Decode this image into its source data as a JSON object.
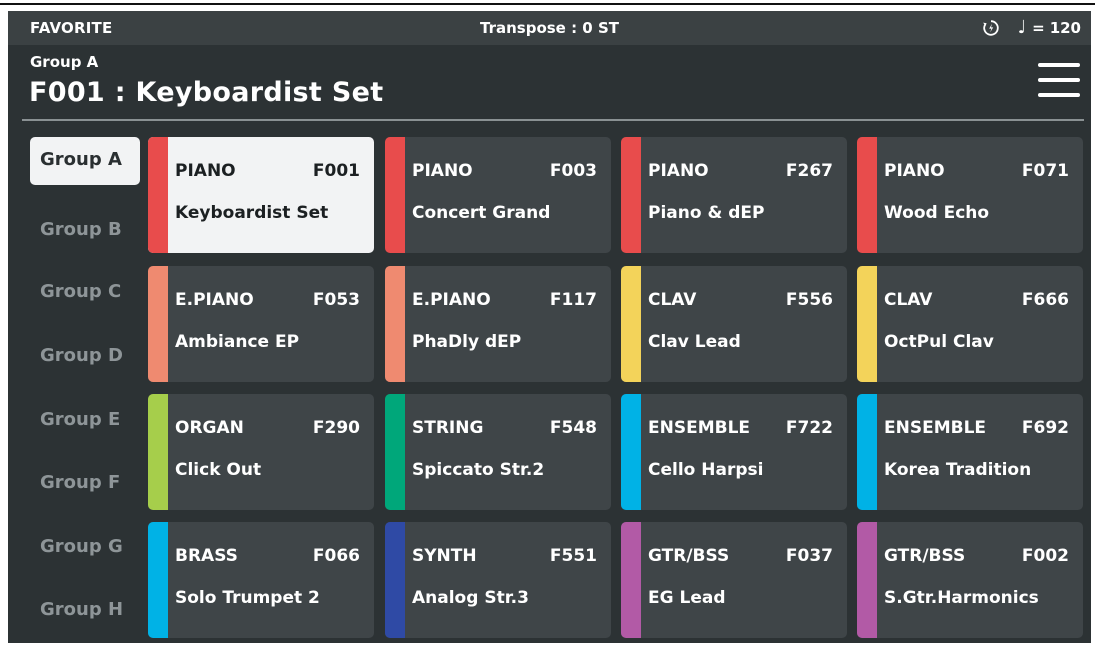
{
  "statusbar": {
    "mode": "FAVORITE",
    "transpose": "Transpose : 0 ST",
    "sync_icon": "sync-icon",
    "note_icon": "quarter-note-icon",
    "note_glyph": "♩",
    "tempo_eq": "=",
    "tempo": "120"
  },
  "header": {
    "group": "Group A",
    "title": "F001 : Keyboardist Set",
    "menu_icon": "hamburger-menu-icon"
  },
  "groups": [
    {
      "label": "Group A",
      "active": true
    },
    {
      "label": "Group B",
      "active": false
    },
    {
      "label": "Group C",
      "active": false
    },
    {
      "label": "Group D",
      "active": false
    },
    {
      "label": "Group E",
      "active": false
    },
    {
      "label": "Group F",
      "active": false
    },
    {
      "label": "Group G",
      "active": false
    },
    {
      "label": "Group H",
      "active": false
    }
  ],
  "colors": {
    "piano": "#e84c4c",
    "epiano": "#ef8a70",
    "clav": "#f3d35a",
    "organ": "#a6ce4b",
    "string": "#00a77a",
    "ensemble": "#00b2e6",
    "brass": "#00b2e6",
    "synth": "#2f4aa5",
    "gtrbss": "#b25aa6",
    "screen_bg": "#2c3234",
    "tile_bg": "#3f4548",
    "selected_bg": "#f2f3f4"
  },
  "tiles": [
    {
      "category": "PIANO",
      "number": "F001",
      "name": "Keyboardist Set",
      "color": "#e84c4c",
      "selected": true
    },
    {
      "category": "PIANO",
      "number": "F003",
      "name": "Concert Grand",
      "color": "#e84c4c",
      "selected": false
    },
    {
      "category": "PIANO",
      "number": "F267",
      "name": "Piano & dEP",
      "color": "#e84c4c",
      "selected": false
    },
    {
      "category": "PIANO",
      "number": "F071",
      "name": "Wood Echo",
      "color": "#e84c4c",
      "selected": false
    },
    {
      "category": "E.PIANO",
      "number": "F053",
      "name": "Ambiance EP",
      "color": "#ef8a70",
      "selected": false
    },
    {
      "category": "E.PIANO",
      "number": "F117",
      "name": "PhaDly dEP",
      "color": "#ef8a70",
      "selected": false
    },
    {
      "category": "CLAV",
      "number": "F556",
      "name": "Clav Lead",
      "color": "#f3d35a",
      "selected": false
    },
    {
      "category": "CLAV",
      "number": "F666",
      "name": "OctPul Clav",
      "color": "#f3d35a",
      "selected": false
    },
    {
      "category": "ORGAN",
      "number": "F290",
      "name": "Click Out",
      "color": "#a6ce4b",
      "selected": false
    },
    {
      "category": "STRING",
      "number": "F548",
      "name": "Spiccato Str.2",
      "color": "#00a77a",
      "selected": false
    },
    {
      "category": "ENSEMBLE",
      "number": "F722",
      "name": "Cello Harpsi",
      "color": "#00b2e6",
      "selected": false
    },
    {
      "category": "ENSEMBLE",
      "number": "F692",
      "name": "Korea Tradition",
      "color": "#00b2e6",
      "selected": false
    },
    {
      "category": "BRASS",
      "number": "F066",
      "name": "Solo Trumpet 2",
      "color": "#00b2e6",
      "selected": false
    },
    {
      "category": "SYNTH",
      "number": "F551",
      "name": "Analog Str.3",
      "color": "#2f4aa5",
      "selected": false
    },
    {
      "category": "GTR/BSS",
      "number": "F037",
      "name": "EG Lead",
      "color": "#b25aa6",
      "selected": false
    },
    {
      "category": "GTR/BSS",
      "number": "F002",
      "name": "S.Gtr.Harmonics",
      "color": "#b25aa6",
      "selected": false
    }
  ]
}
